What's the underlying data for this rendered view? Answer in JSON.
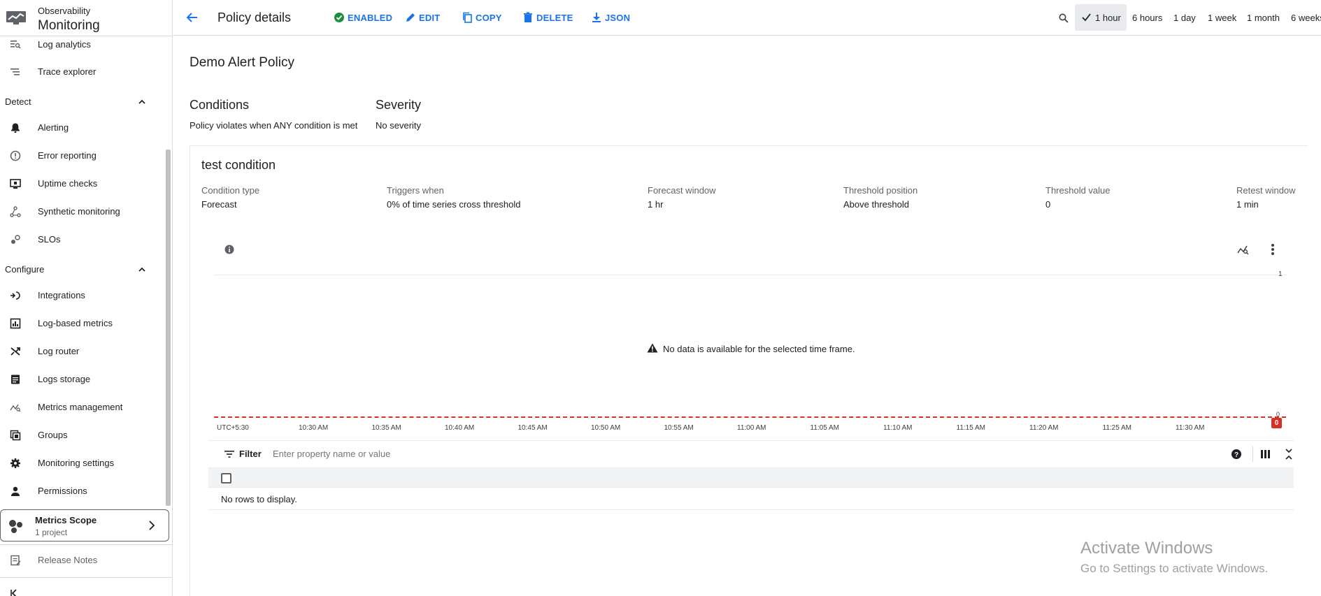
{
  "sidebar": {
    "brand_small": "Observability",
    "brand_big": "Monitoring",
    "items_top": [
      {
        "label": "Log analytics",
        "icon": "log-analytics-icon"
      },
      {
        "label": "Trace explorer",
        "icon": "trace-explorer-icon"
      }
    ],
    "section_detect": "Detect",
    "items_detect": [
      {
        "label": "Alerting",
        "icon": "bell-icon"
      },
      {
        "label": "Error reporting",
        "icon": "error-reporting-icon"
      },
      {
        "label": "Uptime checks",
        "icon": "uptime-checks-icon"
      },
      {
        "label": "Synthetic monitoring",
        "icon": "synthetic-monitoring-icon"
      },
      {
        "label": "SLOs",
        "icon": "slo-icon"
      }
    ],
    "section_configure": "Configure",
    "items_configure": [
      {
        "label": "Integrations",
        "icon": "integrations-icon"
      },
      {
        "label": "Log-based metrics",
        "icon": "log-based-metrics-icon"
      },
      {
        "label": "Log router",
        "icon": "log-router-icon"
      },
      {
        "label": "Logs storage",
        "icon": "logs-storage-icon"
      },
      {
        "label": "Metrics management",
        "icon": "metrics-management-icon"
      },
      {
        "label": "Groups",
        "icon": "groups-icon"
      },
      {
        "label": "Monitoring settings",
        "icon": "gear-icon"
      },
      {
        "label": "Permissions",
        "icon": "person-icon"
      }
    ],
    "scope_title": "Metrics Scope",
    "scope_sub": "1 project",
    "release_notes": "Release Notes"
  },
  "toolbar": {
    "title": "Policy details",
    "enabled": "ENABLED",
    "edit": "EDIT",
    "copy": "COPY",
    "delete": "DELETE",
    "json": "JSON",
    "time_options": [
      "1 hour",
      "6 hours",
      "1 day",
      "1 week",
      "1 month",
      "6 weeks"
    ],
    "selected_time": "1 hour"
  },
  "policy": {
    "name": "Demo Alert Policy",
    "conditions_heading": "Conditions",
    "conditions_text": "Policy violates when ANY condition is met",
    "severity_heading": "Severity",
    "severity_text": "No severity"
  },
  "condition": {
    "title": "test condition",
    "fields": [
      {
        "label": "Condition type",
        "value": "Forecast"
      },
      {
        "label": "Triggers when",
        "value": "0% of time series cross threshold"
      },
      {
        "label": "Forecast window",
        "value": "1 hr"
      },
      {
        "label": "Threshold position",
        "value": "Above threshold"
      },
      {
        "label": "Threshold value",
        "value": "0"
      },
      {
        "label": "Retest window",
        "value": "1 min"
      }
    ]
  },
  "chart": {
    "no_data": "No data is available for the selected time frame.",
    "y_top": "1",
    "y_bottom": "0",
    "threshold_badge": "0",
    "threshold_color": "#d93025",
    "x_labels": [
      "UTC+5:30",
      "10:30 AM",
      "10:35 AM",
      "10:40 AM",
      "10:45 AM",
      "10:50 AM",
      "10:55 AM",
      "11:00 AM",
      "11:05 AM",
      "11:10 AM",
      "11:15 AM",
      "11:20 AM",
      "11:25 AM",
      "11:30 AM"
    ]
  },
  "table": {
    "filter_label": "Filter",
    "filter_placeholder": "Enter property name or value",
    "empty_text": "No rows to display."
  },
  "watermark": {
    "line1": "Activate Windows",
    "line2": "Go to Settings to activate Windows."
  },
  "colors": {
    "accent": "#1a73e8",
    "enabled_green": "#1e8e3e"
  }
}
